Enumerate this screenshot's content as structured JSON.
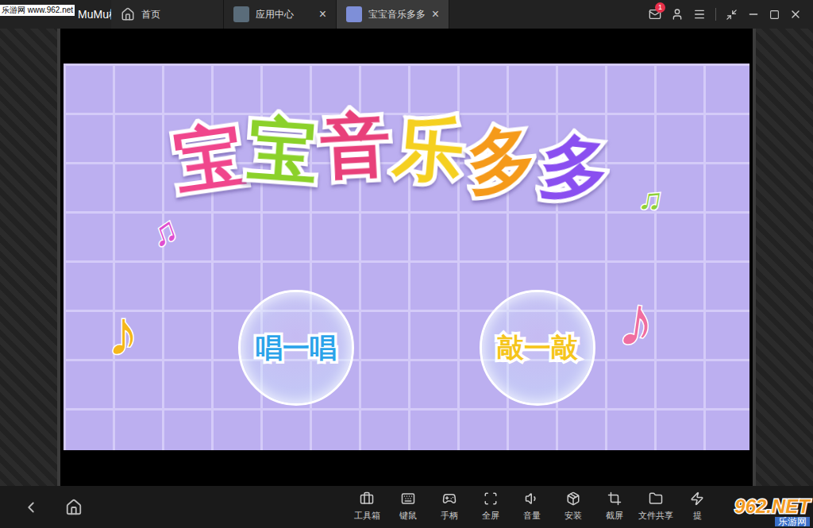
{
  "window": {
    "title": "MuMu模拟器"
  },
  "watermark": {
    "top": "乐游网 www.962.net",
    "bottom_logo": "962.NET",
    "bottom_text": "乐游网"
  },
  "tabs": [
    {
      "label": "首页",
      "selected": false,
      "closable": false
    },
    {
      "label": "应用中心",
      "selected": false,
      "closable": true
    },
    {
      "label": "宝宝音乐多多",
      "selected": true,
      "closable": true
    }
  ],
  "close_glyph": "×",
  "notifications": {
    "count": "1"
  },
  "game": {
    "title": [
      {
        "char": "宝",
        "color": "#f0468c"
      },
      {
        "char": "宝",
        "color": "#8bd12a"
      },
      {
        "char": "音",
        "color": "#e8407a"
      },
      {
        "char": "乐",
        "color": "#f5d020"
      },
      {
        "char": "多",
        "color": "#f59a1a"
      },
      {
        "char": "多",
        "color": "#8a4ff0"
      }
    ],
    "buttons": [
      {
        "label": "唱一唱",
        "color": "#2ba3ea"
      },
      {
        "label": "敲一敲",
        "color": "#f5c51c"
      }
    ],
    "notes": [
      {
        "char": "♫",
        "color": "#e04fd0"
      },
      {
        "char": "♫",
        "color": "#8fd13a"
      },
      {
        "char": "♪",
        "color": "#f5b81c"
      },
      {
        "char": "♪",
        "color": "#f06ea0"
      }
    ]
  },
  "toolbar": [
    "工具箱",
    "键鼠",
    "手柄",
    "全屏",
    "音量",
    "安装",
    "截屏",
    "文件共享",
    "提"
  ]
}
